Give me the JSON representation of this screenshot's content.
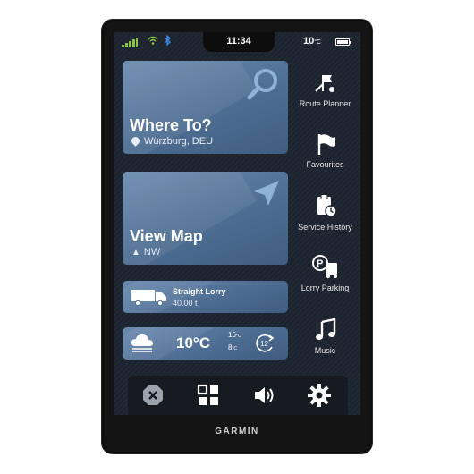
{
  "status": {
    "time": "11:34",
    "temperature": "10",
    "temperature_unit": "°C",
    "icons": [
      "signal-icon",
      "wifi-icon",
      "bluetooth-icon",
      "battery-icon"
    ]
  },
  "tiles": {
    "where_to": {
      "title": "Where To?",
      "location": "Würzburg, DEU"
    },
    "view_map": {
      "title": "View Map",
      "heading": "NW"
    },
    "vehicle": {
      "name": "Straight Lorry",
      "weight": "40.00 t"
    },
    "weather": {
      "temperature": "10°C",
      "high": "16",
      "low": "8",
      "unit_small": "°C",
      "forecast_hour": "12"
    }
  },
  "sidebar": {
    "items": [
      {
        "label": "Route Planner",
        "icon": "route-planner-icon"
      },
      {
        "label": "Favourites",
        "icon": "flag-icon"
      },
      {
        "label": "Service History",
        "icon": "clipboard-clock-icon"
      },
      {
        "label": "Lorry Parking",
        "icon": "parking-truck-icon"
      },
      {
        "label": "Music",
        "icon": "music-note-icon"
      }
    ]
  },
  "bottombar": {
    "buttons": [
      "close-icon",
      "apps-grid-icon",
      "volume-icon",
      "settings-gear-icon"
    ]
  },
  "device": {
    "brand": "GARMIN"
  },
  "colors": {
    "tile": "#4d6d92",
    "screen": "#1c2430",
    "signal": "#8bc34a",
    "bluetooth": "#3d8ee8"
  }
}
